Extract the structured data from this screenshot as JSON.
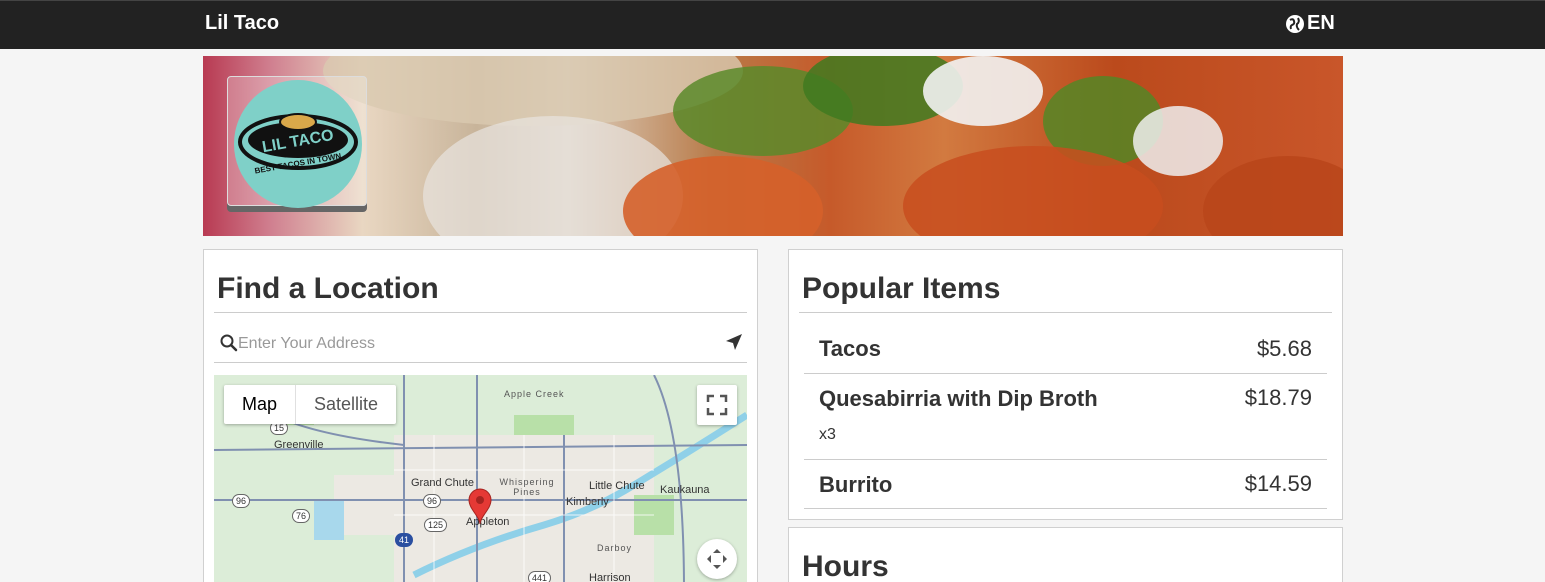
{
  "header": {
    "brand": "Lil Taco",
    "language": "EN"
  },
  "logo": {
    "text_top": "LIL TACO",
    "text_bottom": "BEST TACOS IN TOWN"
  },
  "find_location": {
    "title": "Find a Location",
    "search_placeholder": "Enter Your Address",
    "map": {
      "map_tab": "Map",
      "satellite_tab": "Satellite",
      "labels": [
        "Apple Creek",
        "Greenville",
        "Grand Chute",
        "Whispering Pines",
        "Little Chute",
        "Kaukauna",
        "Kimberly",
        "Appleton",
        "Darboy",
        "Harrison"
      ],
      "shields": [
        "15",
        "96",
        "96",
        "76",
        "125",
        "41",
        "441"
      ]
    }
  },
  "popular": {
    "title": "Popular Items",
    "items": [
      {
        "name": "Tacos",
        "price": "$5.68",
        "qty": ""
      },
      {
        "name": "Quesabirria with Dip Broth",
        "price": "$18.79",
        "qty": "x3"
      },
      {
        "name": "Burrito",
        "price": "$14.59",
        "qty": ""
      }
    ]
  },
  "hours": {
    "title": "Hours"
  }
}
